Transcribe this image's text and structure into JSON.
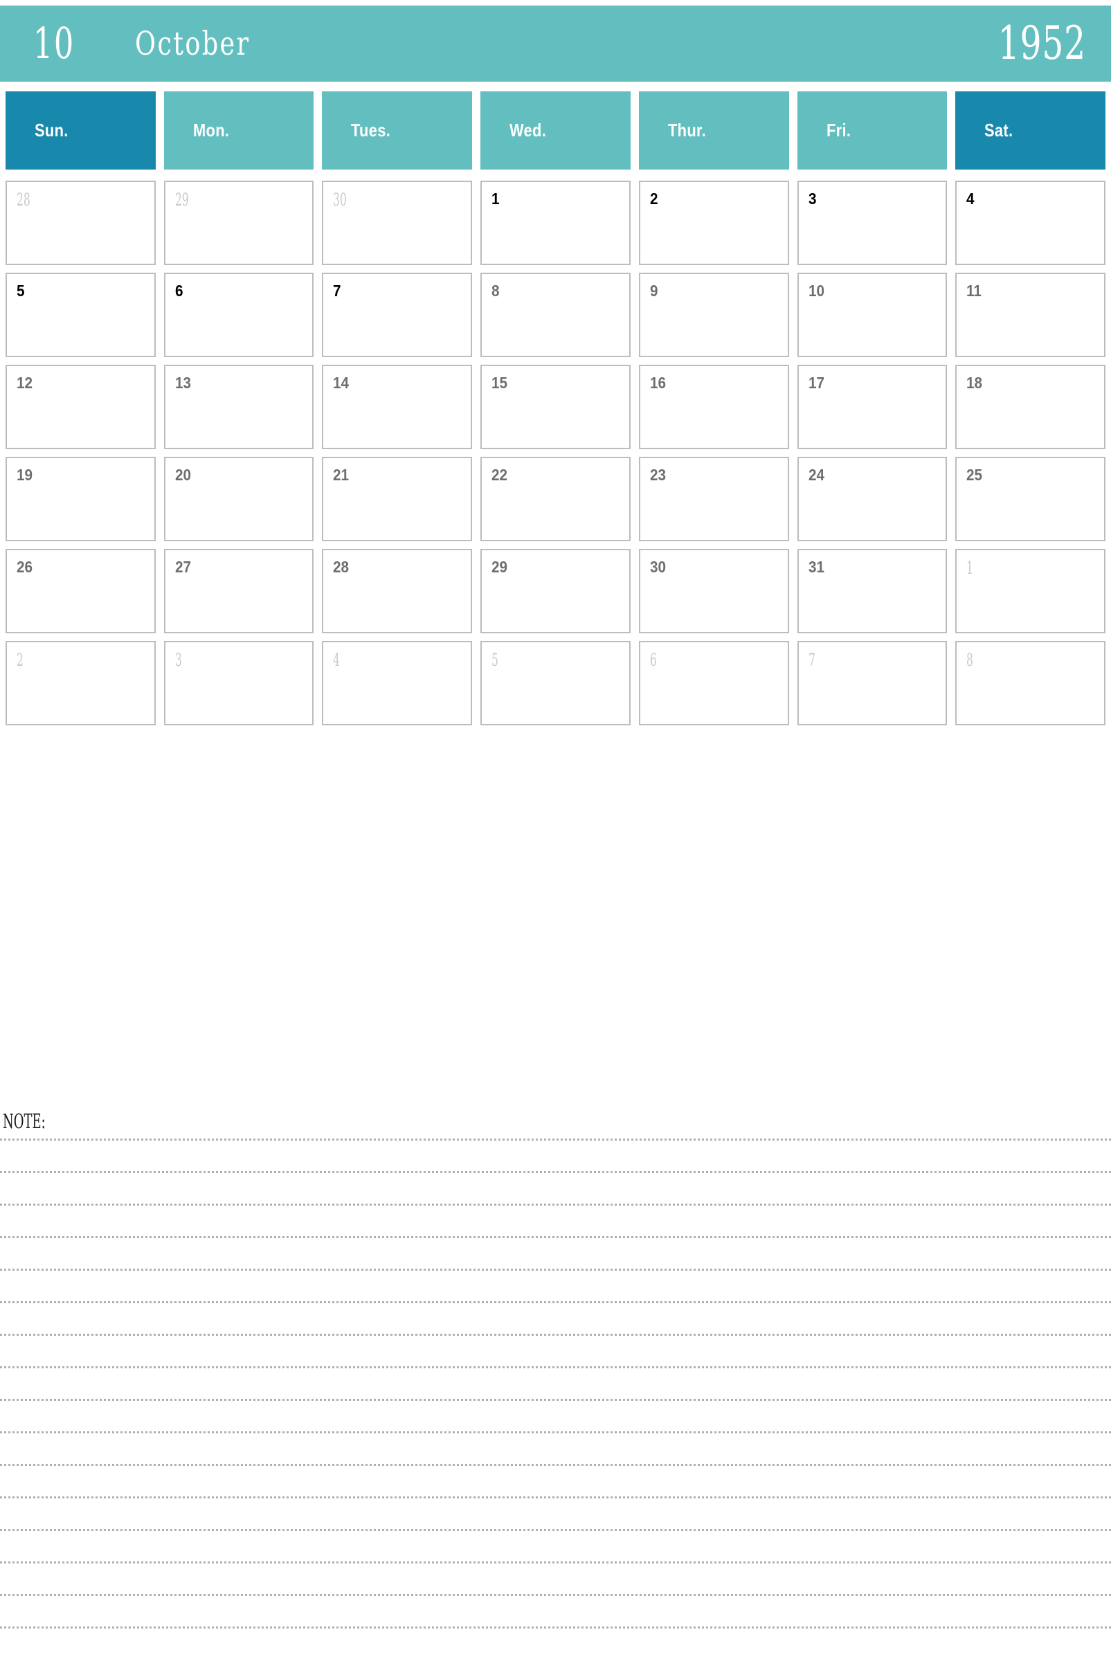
{
  "colors": {
    "teal": "#63bfbf",
    "weekend_blue": "#1888ac",
    "cell_border": "#bdbdbd",
    "dim_text": "#6e6e6e",
    "adjacent_text": "#c9c9c9"
  },
  "masthead": {
    "month_number": "10",
    "month_name": "October",
    "year": "1952"
  },
  "weekday_headers": [
    {
      "label": "Sun.",
      "weekend": true
    },
    {
      "label": "Mon.",
      "weekend": false
    },
    {
      "label": "Tues.",
      "weekend": false
    },
    {
      "label": "Wed.",
      "weekend": false
    },
    {
      "label": "Thur.",
      "weekend": false
    },
    {
      "label": "Fri.",
      "weekend": false
    },
    {
      "label": "Sat.",
      "weekend": true
    }
  ],
  "weeks": [
    [
      {
        "day": "28",
        "style": "adjacent"
      },
      {
        "day": "29",
        "style": "adjacent"
      },
      {
        "day": "30",
        "style": "adjacent"
      },
      {
        "day": "1",
        "style": "bold"
      },
      {
        "day": "2",
        "style": "bold"
      },
      {
        "day": "3",
        "style": "bold"
      },
      {
        "day": "4",
        "style": "bold"
      }
    ],
    [
      {
        "day": "5",
        "style": "bold"
      },
      {
        "day": "6",
        "style": "bold"
      },
      {
        "day": "7",
        "style": "bold"
      },
      {
        "day": "8",
        "style": "dim"
      },
      {
        "day": "9",
        "style": "dim"
      },
      {
        "day": "10",
        "style": "dim"
      },
      {
        "day": "11",
        "style": "dim"
      }
    ],
    [
      {
        "day": "12",
        "style": "dim"
      },
      {
        "day": "13",
        "style": "dim"
      },
      {
        "day": "14",
        "style": "dim"
      },
      {
        "day": "15",
        "style": "dim"
      },
      {
        "day": "16",
        "style": "dim"
      },
      {
        "day": "17",
        "style": "dim"
      },
      {
        "day": "18",
        "style": "dim"
      }
    ],
    [
      {
        "day": "19",
        "style": "dim"
      },
      {
        "day": "20",
        "style": "dim"
      },
      {
        "day": "21",
        "style": "dim"
      },
      {
        "day": "22",
        "style": "dim"
      },
      {
        "day": "23",
        "style": "dim"
      },
      {
        "day": "24",
        "style": "dim"
      },
      {
        "day": "25",
        "style": "dim"
      }
    ],
    [
      {
        "day": "26",
        "style": "dim"
      },
      {
        "day": "27",
        "style": "dim"
      },
      {
        "day": "28",
        "style": "dim"
      },
      {
        "day": "29",
        "style": "dim"
      },
      {
        "day": "30",
        "style": "dim"
      },
      {
        "day": "31",
        "style": "dim"
      },
      {
        "day": "1",
        "style": "adjacent"
      }
    ],
    [
      {
        "day": "2",
        "style": "adjacent"
      },
      {
        "day": "3",
        "style": "adjacent"
      },
      {
        "day": "4",
        "style": "adjacent"
      },
      {
        "day": "5",
        "style": "adjacent"
      },
      {
        "day": "6",
        "style": "adjacent"
      },
      {
        "day": "7",
        "style": "adjacent"
      },
      {
        "day": "8",
        "style": "adjacent"
      }
    ]
  ],
  "note": {
    "label": "NOTE:",
    "line_count": 16
  }
}
